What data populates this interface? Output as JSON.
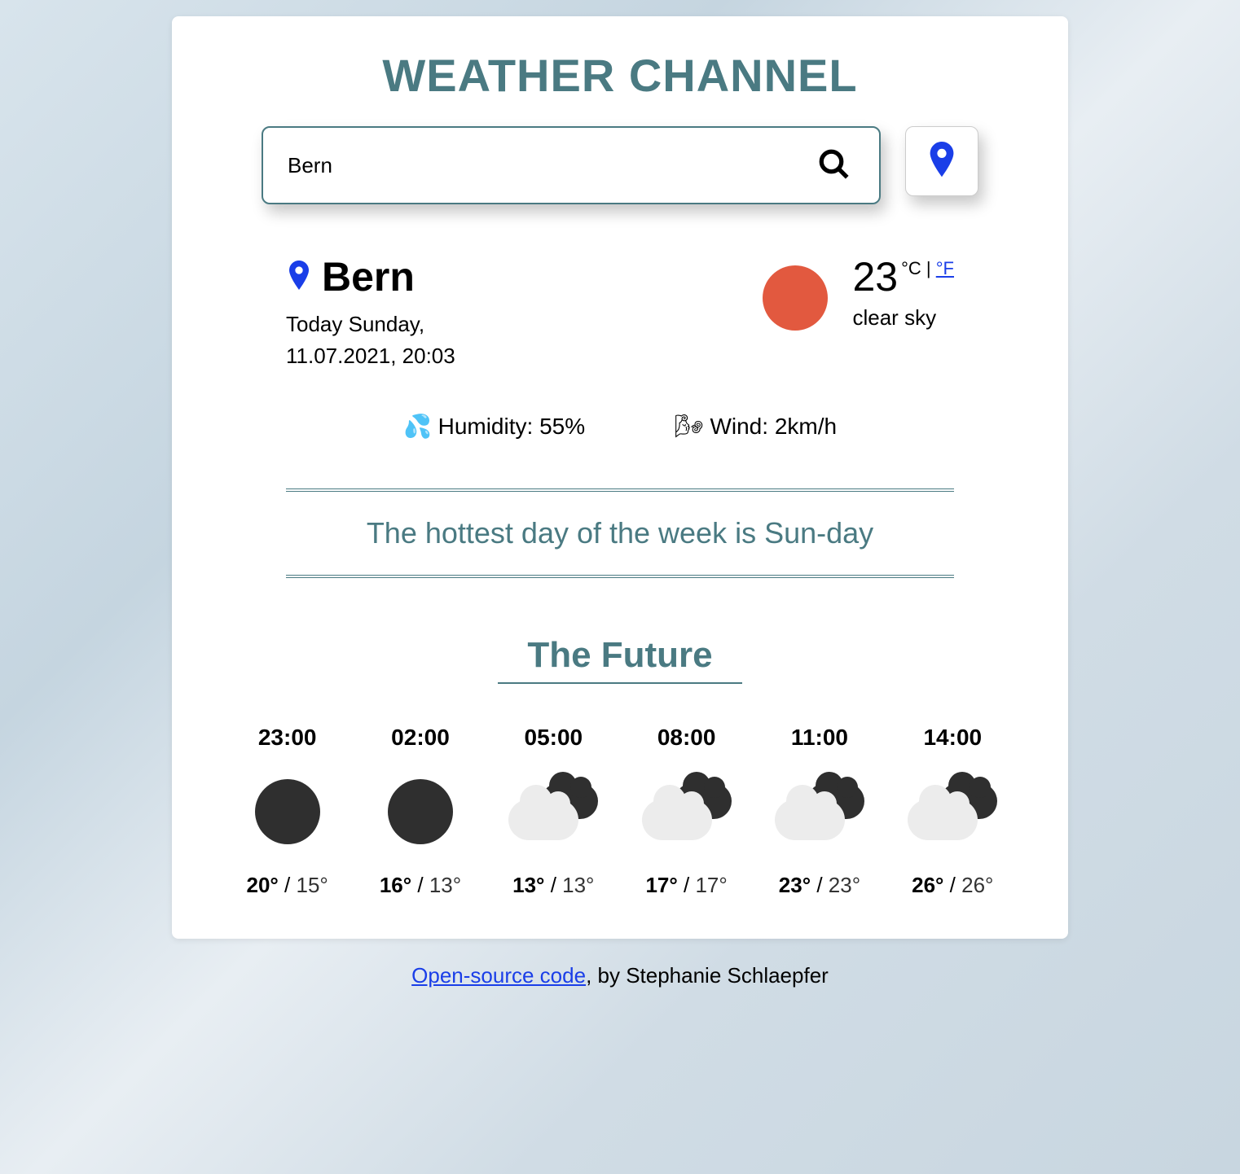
{
  "title": "WEATHER CHANNEL",
  "search": {
    "value": "Bern",
    "placeholder": ""
  },
  "location": {
    "city": "Bern",
    "date_line1": "Today Sunday,",
    "date_line2": "11.07.2021, 20:03"
  },
  "current": {
    "temp": "23",
    "unit_c": "°C",
    "unit_sep": " | ",
    "unit_f": "°F",
    "desc": "clear sky",
    "icon": "sun"
  },
  "stats": {
    "humidity_label": "Humidity:",
    "humidity_value": "55%",
    "humidity_emoji": "💦",
    "wind_label": "Wind:",
    "wind_value": "2km/h",
    "wind_emoji": "🌬"
  },
  "quote": "The hottest day of the week is Sun-day",
  "future_title": "The Future",
  "forecast": [
    {
      "time": "23:00",
      "icon": "moon",
      "hi": "20°",
      "lo": "15°"
    },
    {
      "time": "02:00",
      "icon": "moon",
      "hi": "16°",
      "lo": "13°"
    },
    {
      "time": "05:00",
      "icon": "cloud",
      "hi": "13°",
      "lo": "13°"
    },
    {
      "time": "08:00",
      "icon": "cloud",
      "hi": "17°",
      "lo": "17°"
    },
    {
      "time": "11:00",
      "icon": "cloud",
      "hi": "23°",
      "lo": "23°"
    },
    {
      "time": "14:00",
      "icon": "cloud",
      "hi": "26°",
      "lo": "26°"
    }
  ],
  "footer": {
    "link_text": "Open-source code",
    "rest": ", by Stephanie Schlaepfer"
  }
}
